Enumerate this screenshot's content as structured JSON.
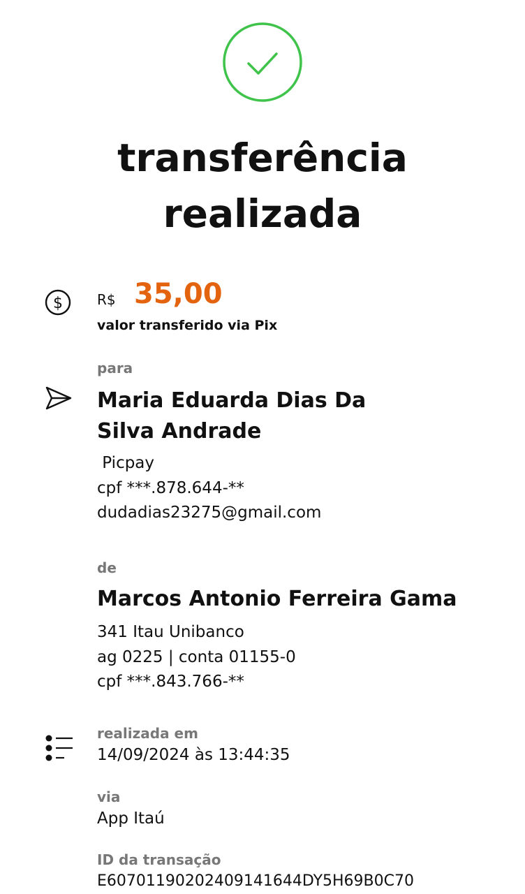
{
  "status": {
    "title_line1": "transferência",
    "title_line2": "realizada",
    "success_color": "#3fc34a"
  },
  "amount": {
    "currency": "R$",
    "value": "35,00",
    "caption": "valor transferido via Pix",
    "accent_color": "#e3630f"
  },
  "recipient": {
    "label": "para",
    "name_line1": "Maria Eduarda Dias Da",
    "name_line2": "Silva Andrade",
    "bank": " Picpay",
    "cpf": "cpf ***.878.644-**",
    "pix_key": "dudadias23275@gmail.com"
  },
  "sender": {
    "label": "de",
    "name": "Marcos Antonio Ferreira Gama",
    "bank": "341 Itau Unibanco",
    "account": "ag 0225 | conta 01155-0",
    "cpf": "cpf ***.843.766-**"
  },
  "details": {
    "date_label": "realizada em",
    "date_value": "14/09/2024 às 13:44:35",
    "via_label": "via",
    "via_value": "App Itaú",
    "id_label": "ID da transação",
    "id_value": "E60701190202409141644DY5H69B0C70"
  },
  "icons": {
    "success": "check-circle-icon",
    "amount": "dollar-circle-icon",
    "recipient": "send-icon",
    "details": "list-icon"
  }
}
